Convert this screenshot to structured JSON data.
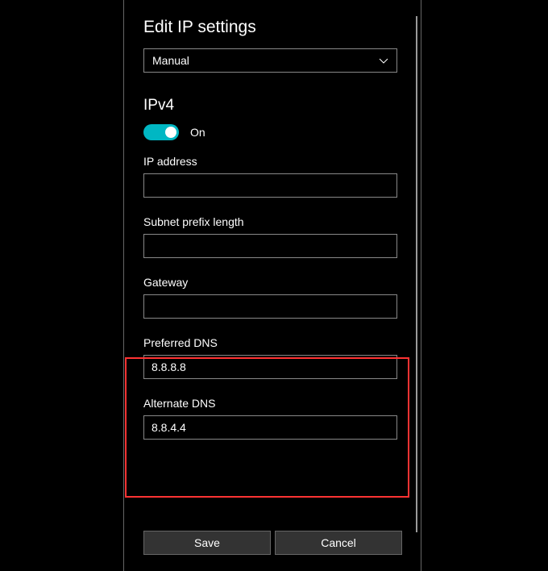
{
  "title": "Edit IP settings",
  "dropdown": {
    "selected": "Manual"
  },
  "ipv4": {
    "heading": "IPv4",
    "toggle_state": "On"
  },
  "fields": {
    "ip_address": {
      "label": "IP address",
      "value": ""
    },
    "subnet": {
      "label": "Subnet prefix length",
      "value": ""
    },
    "gateway": {
      "label": "Gateway",
      "value": ""
    },
    "preferred_dns": {
      "label": "Preferred DNS",
      "value": "8.8.8.8"
    },
    "alternate_dns": {
      "label": "Alternate DNS",
      "value": "8.8.4.4"
    }
  },
  "buttons": {
    "save": "Save",
    "cancel": "Cancel"
  }
}
